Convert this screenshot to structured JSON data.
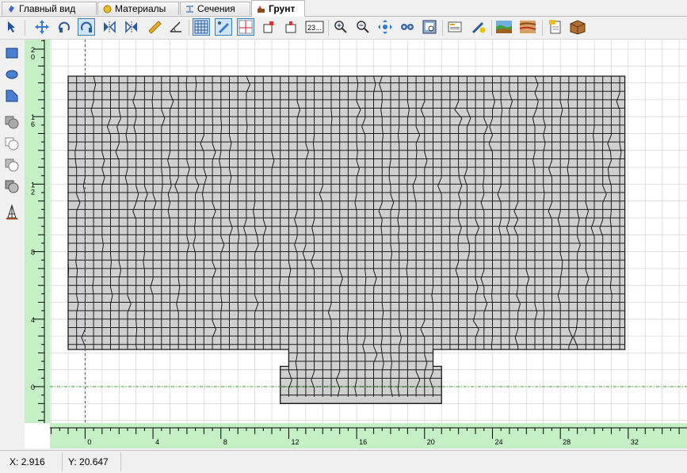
{
  "tabs": [
    {
      "label": "Главный вид",
      "icon": "main-view-icon",
      "active": false
    },
    {
      "label": "Материалы",
      "icon": "materials-icon",
      "active": false
    },
    {
      "label": "Сечения",
      "icon": "sections-icon",
      "active": false
    },
    {
      "label": "Грунт",
      "icon": "soil-icon",
      "active": true
    }
  ],
  "toolbar": {
    "buttons": [
      {
        "name": "pointer-tool-icon"
      },
      {
        "name": "pan-tool-icon"
      },
      {
        "name": "rotate-tool-icon",
        "pressed": true
      },
      {
        "name": "mirror-horizontal-icon"
      },
      {
        "name": "mirror-vertical-icon"
      },
      {
        "name": "ruler-measure-icon"
      },
      {
        "name": "angle-measure-icon"
      },
      {
        "name": "grid-toggle-icon",
        "pressed": true
      },
      {
        "name": "snap-toggle-icon",
        "pressed": true
      },
      {
        "name": "axes-toggle-icon",
        "pressed": true
      },
      {
        "name": "object-snap-icon"
      },
      {
        "name": "node-snap-icon"
      },
      {
        "name": "numbering-icon",
        "text": "23..."
      },
      {
        "name": "zoom-in-icon"
      },
      {
        "name": "zoom-out-icon"
      },
      {
        "name": "zoom-extents-icon"
      },
      {
        "name": "settings-gears-icon"
      },
      {
        "name": "print-preview-icon"
      },
      {
        "name": "view-options-icon"
      },
      {
        "name": "mesh-generate-icon"
      },
      {
        "name": "soil-layers-icon"
      },
      {
        "name": "soil-properties-icon"
      },
      {
        "name": "report-icon"
      },
      {
        "name": "box-3d-icon"
      }
    ]
  },
  "left_tools": [
    "rectangle-shape-icon",
    "ellipse-shape-icon",
    "polygon-shape-icon",
    "boolean-union-icon",
    "boolean-subtract-icon",
    "boolean-intersect-icon",
    "boolean-split-icon",
    "pile-icon"
  ],
  "ruler": {
    "x_labels": [
      "0",
      "4",
      "8",
      "12",
      "16",
      "20",
      "24",
      "28",
      "32"
    ],
    "y_labels": [
      "20",
      "16",
      "12",
      "8",
      "4",
      "0"
    ]
  },
  "status": {
    "x_label": "X:",
    "x_value": "2.916",
    "y_label": "Y:",
    "y_value": "20.647"
  },
  "model": {
    "outline": [
      [
        -1,
        18.4
      ],
      [
        31.8,
        18.4
      ],
      [
        31.8,
        2.2
      ],
      [
        20.5,
        2.2
      ],
      [
        20.5,
        1.2
      ],
      [
        21,
        1.2
      ],
      [
        21,
        -1
      ],
      [
        11.5,
        -1
      ],
      [
        11.5,
        1.2
      ],
      [
        12,
        1.2
      ],
      [
        12,
        2.2
      ],
      [
        -1,
        2.2
      ]
    ],
    "cell_size": 0.5,
    "colors": {
      "mesh_fill": "#d0d0d0",
      "mesh_line": "#1a1a1a",
      "grid_line": "#d8d8d8",
      "axis_x": "#2aa02a",
      "axis_y": "#4040d0",
      "ruler": "#c5efc5"
    }
  }
}
